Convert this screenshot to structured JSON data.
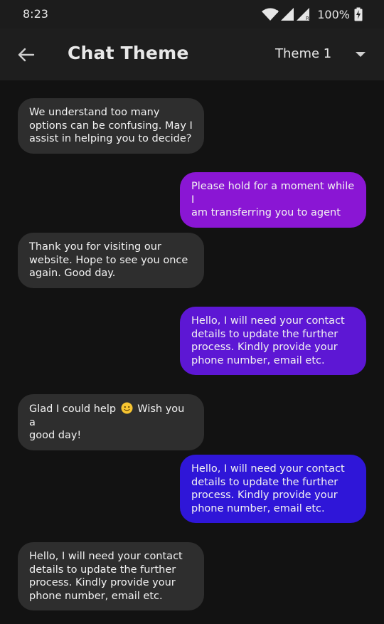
{
  "status_bar": {
    "time": "8:23",
    "battery": "100%",
    "icons": [
      "wifi-icon",
      "signal-icon",
      "signal-roaming-icon",
      "battery-charging-icon"
    ]
  },
  "app_bar": {
    "back_icon": "arrow-left-icon",
    "title": "Chat Theme",
    "theme_dropdown": {
      "selected": "Theme 1",
      "icon": "dropdown-caret-icon"
    }
  },
  "messages": [
    {
      "side": "incoming",
      "text": "We understand too many\noptions can be confusing. May I\nassist in helping you to decide?"
    },
    {
      "side": "outgoing",
      "text": "Please hold for a moment while I\nam transferring you to agent",
      "color": "#8a16d4"
    },
    {
      "side": "incoming",
      "text": "Thank you for visiting our\nwebsite. Hope to see you once\nagain. Good day."
    },
    {
      "side": "outgoing",
      "text": "Hello, I will need your contact\ndetails to update the further\nprocess. Kindly provide your\nphone number, email etc.",
      "color": "#5d17d4"
    },
    {
      "side": "incoming",
      "text_before_emoji": "Glad I could help",
      "emoji": "slightly-smiling-face",
      "text_after_emoji": "Wish you a\ngood day!"
    },
    {
      "side": "outgoing",
      "text": "Hello, I will need your contact\ndetails to update the further\nprocess. Kindly provide your\nphone number, email etc.",
      "color": "#2f16d8"
    },
    {
      "side": "incoming",
      "text": "Hello, I will need your contact\ndetails to update the further\nprocess. Kindly provide your\nphone number, email etc."
    }
  ],
  "colors": {
    "background": "#121212",
    "app_bar": "#1e1e1e",
    "incoming_bubble": "#2e2e2e"
  }
}
